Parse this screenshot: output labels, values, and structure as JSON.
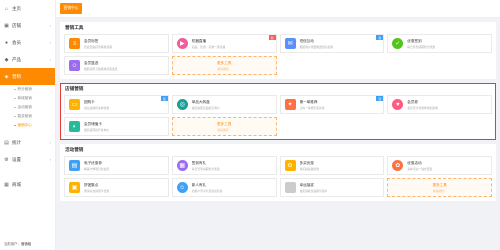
{
  "sidebar": {
    "items": [
      {
        "label": "主页",
        "icon": "home-icon",
        "glyph": "⌂"
      },
      {
        "label": "店铺",
        "icon": "store-icon",
        "glyph": "▣",
        "chev": "‹"
      },
      {
        "label": "会员",
        "icon": "member-icon",
        "glyph": "●",
        "chev": "‹"
      },
      {
        "label": "产品",
        "icon": "product-icon",
        "glyph": "◆",
        "chev": "‹"
      },
      {
        "label": "营销",
        "icon": "marketing-icon",
        "glyph": "◈",
        "chev": "‹"
      }
    ],
    "subitems": [
      "积分营销",
      "商城营销",
      "活动营销",
      "裂变营销",
      "营销中心"
    ],
    "items_after": [
      {
        "label": "统计",
        "icon": "stats-icon",
        "glyph": "▤",
        "chev": "‹"
      },
      {
        "label": "设置",
        "icon": "settings-icon",
        "glyph": "⚙",
        "chev": "‹"
      },
      {
        "label": "商城",
        "icon": "mall-icon",
        "glyph": "▦"
      }
    ],
    "footer_label": "当前用户：",
    "footer_user": "营销组"
  },
  "topbar": {
    "active_tab": "营销中心"
  },
  "sections": [
    {
      "title": "营销工具",
      "cards": [
        {
          "name": "会员标签",
          "desc": "给会员贴标签精准营销",
          "color": "#ff8a00",
          "glyph": "≡",
          "badge": ""
        },
        {
          "name": "机器直播",
          "desc": "商品、优惠、实物一键直播",
          "color": "#f05c9a",
          "glyph": "▶",
          "badge": "新"
        },
        {
          "name": "短信互动",
          "desc": "根据用户需要推送短信提醒",
          "color": "#5b8ff9",
          "glyph": "✉",
          "badge": "新"
        },
        {
          "name": "优惠签到",
          "desc": "每日签到领取积分优惠",
          "color": "#52c41a",
          "glyph": "✓",
          "badge": ""
        },
        {
          "name": "会员篮选",
          "desc": "根据消费习惯精准筛选会员",
          "color": "#9b6cf0",
          "glyph": "☺",
          "badge": ""
        }
      ],
      "more": {
        "title": "更多工具",
        "subtitle": "敬请期待..."
      }
    },
    {
      "title": "店铺营销",
      "highlighted": true,
      "cards": [
        {
          "name": "团购卡",
          "desc": "满立减满折多种优惠",
          "color": "#ffb300",
          "glyph": "▭",
          "badge": "新"
        },
        {
          "name": "单品大转盘",
          "desc": "抽奖赢取奖品吸引用户",
          "color": "#1aa094",
          "glyph": "◎",
          "badge": ""
        },
        {
          "name": "第一单推荐",
          "desc": "让每一单都带来新客",
          "color": "#ff7043",
          "glyph": "✦",
          "badge": "新"
        },
        {
          "name": "会员券",
          "desc": "会员专享优惠券增加复购",
          "color": "#ff5b7f",
          "glyph": "♥",
          "badge": ""
        },
        {
          "name": "会员储值卡",
          "desc": "储值返现提升客单价",
          "color": "#26b99a",
          "glyph": "◐",
          "badge": ""
        }
      ],
      "more": {
        "title": "更多工具",
        "subtitle": "敬请期待..."
      }
    },
    {
      "title": "活动营销",
      "cards": [
        {
          "name": "电子优惠券",
          "desc": "精美卡券吸引新会员",
          "color": "#3fa1f6",
          "glyph": "▤",
          "badge": ""
        },
        {
          "name": "签到有礼",
          "desc": "每日签到领取积分奖励",
          "color": "#9b6cf0",
          "glyph": "▦",
          "badge": ""
        },
        {
          "name": "多买优惠",
          "desc": "购买越多越优惠",
          "color": "#ffb300",
          "glyph": "⚙",
          "badge": ""
        },
        {
          "name": "优惠活动",
          "desc": "多种活动一站式配置",
          "color": "#ff7043",
          "glyph": "✿",
          "badge": ""
        },
        {
          "name": "拼团集点",
          "desc": "邀请好友拼团享优惠",
          "color": "#ffb300",
          "glyph": "▣",
          "badge": ""
        },
        {
          "name": "新人有礼",
          "desc": "新用户专享礼包欢迎新客",
          "color": "#3fa1f6",
          "glyph": "☺",
          "badge": ""
        },
        {
          "name": "幸运抽奖",
          "desc": "抽奖赢取奖品吸引用户",
          "color": "#cccccc",
          "glyph": "",
          "badge": ""
        }
      ],
      "more": {
        "title": "更多工具",
        "subtitle": "敬请期待..."
      }
    }
  ]
}
